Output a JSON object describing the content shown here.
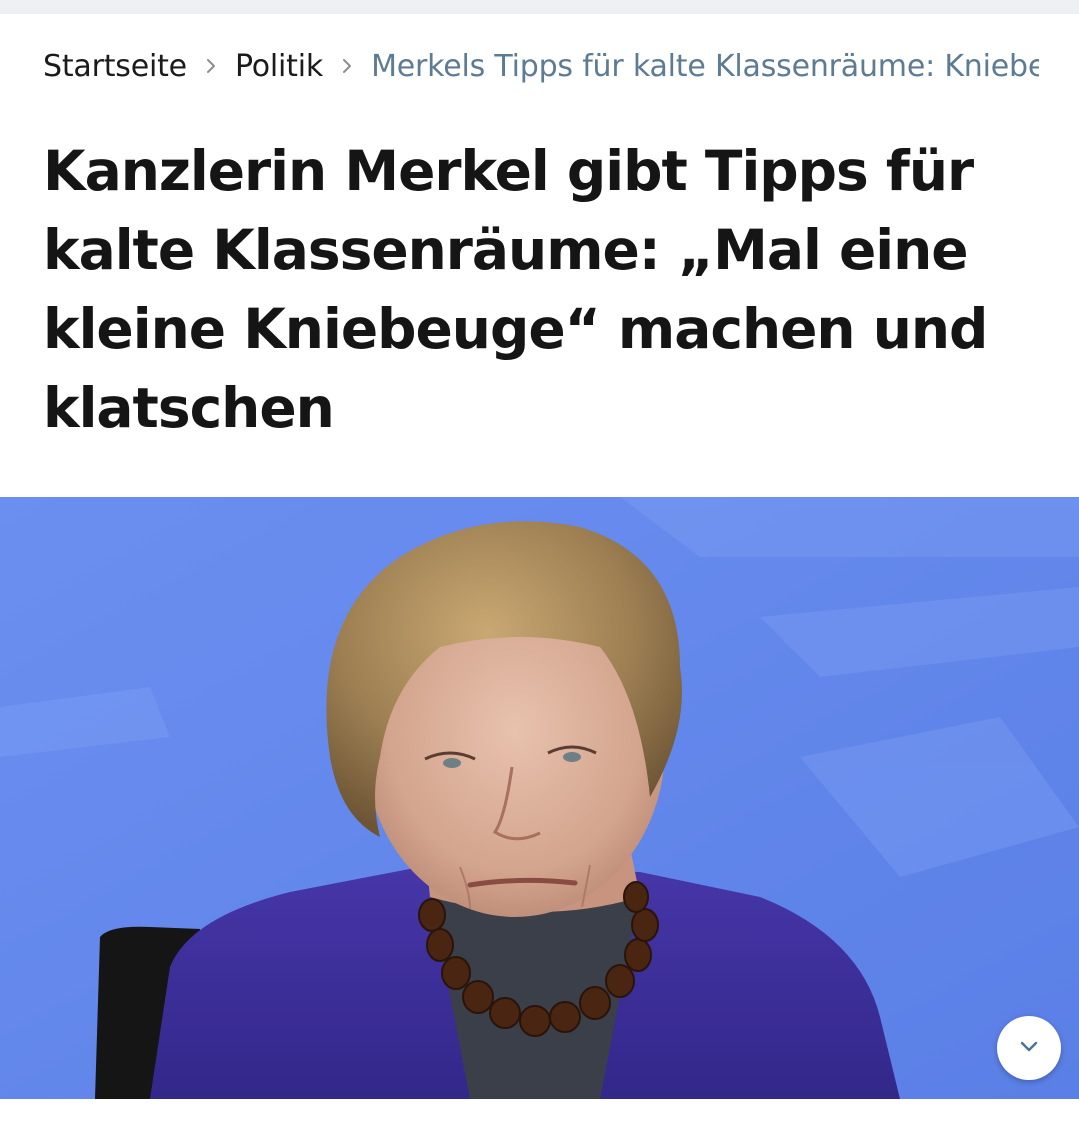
{
  "breadcrumb": {
    "home": "Startseite",
    "section": "Politik",
    "current": "Merkels Tipps für kalte Klassenräume: Kniebeuge"
  },
  "article": {
    "headline": "Kanzlerin Merkel gibt Tipps für kalte Klassenräume: „Mal eine kleine Kniebeuge“ machen und klatschen"
  },
  "icons": {
    "breadcrumb_separator": "chevron-right-icon",
    "scroll_button": "chevron-down-icon"
  },
  "colors": {
    "headline_text": "#151515",
    "breadcrumb_current": "#5d7c93",
    "photo_background": "#5f84ea"
  }
}
